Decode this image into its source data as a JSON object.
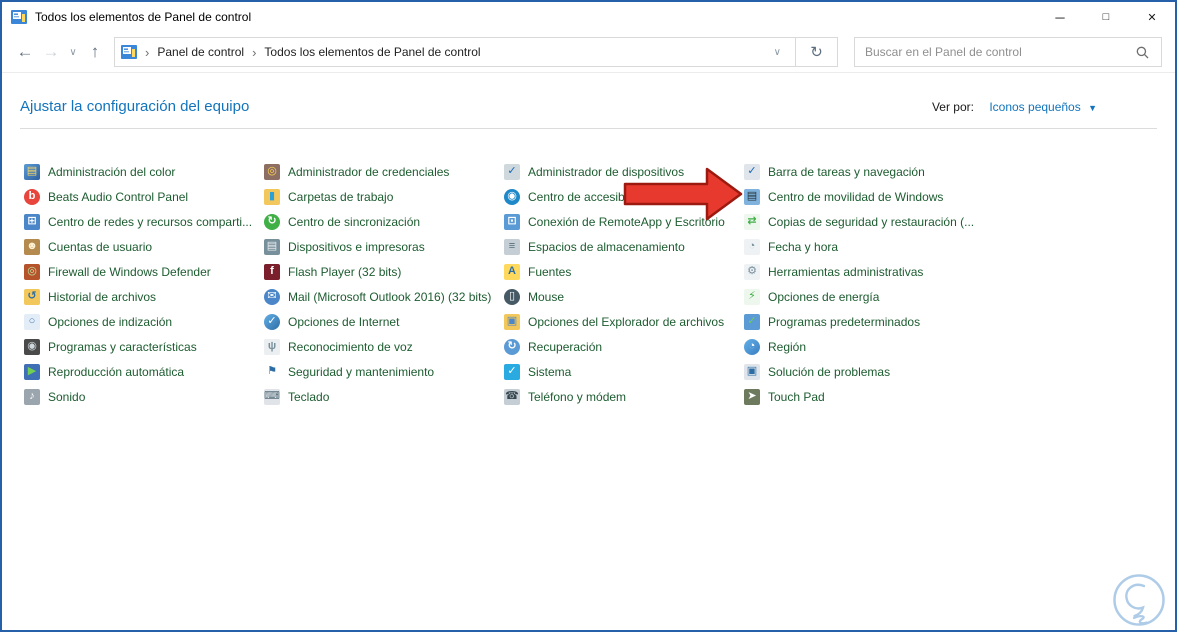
{
  "window": {
    "title": "Todos los elementos de Panel de control",
    "minimize_glyph": "─",
    "maximize_glyph": "□",
    "close_glyph": "✕"
  },
  "navbar": {
    "back_glyph": "←",
    "forward_glyph": "→",
    "dropdown_glyph": "∨",
    "up_glyph": "↑",
    "crumb_sep": "›",
    "breadcrumb_1": "Panel de control",
    "breadcrumb_2": "Todos los elementos de Panel de control",
    "address_dropdown_glyph": "∨",
    "refresh_glyph": "↻",
    "search_placeholder": "Buscar en el Panel de control"
  },
  "header": {
    "title": "Ajustar la configuración del equipo",
    "view_by_label": "Ver por:",
    "view_by_value": "Iconos pequeños",
    "view_by_caret": "▼"
  },
  "items": {
    "columns": [
      [
        {
          "label": "Administración del color",
          "icon": "color-management-icon",
          "glyph": "▤",
          "fg": "#ffd95e",
          "bg": "linear-gradient(135deg,#5b9bd5,#2e5f9e)"
        },
        {
          "label": "Beats Audio Control Panel",
          "icon": "beats-audio-icon",
          "glyph": "b",
          "fg": "#ffffff",
          "bg": "#e8453c",
          "shape": "round"
        },
        {
          "label": "Centro de redes y recursos comparti...",
          "icon": "network-sharing-center-icon",
          "glyph": "⊞",
          "fg": "#ffffff",
          "bg": "#4a86c8"
        },
        {
          "label": "Cuentas de usuario",
          "icon": "user-accounts-icon",
          "glyph": "☻",
          "fg": "#fff3d6",
          "bg": "#b58a4e"
        },
        {
          "label": "Firewall de Windows Defender",
          "icon": "windows-defender-firewall-icon",
          "glyph": "◎",
          "fg": "#bfe3a0",
          "bg": "#b5542a"
        },
        {
          "label": "Historial de archivos",
          "icon": "file-history-icon",
          "glyph": "↺",
          "fg": "#2e6da4",
          "bg": "#f2c75c"
        },
        {
          "label": "Opciones de indización",
          "icon": "indexing-options-icon",
          "glyph": "○",
          "fg": "#4a7db5",
          "bg": "#e3edf7"
        },
        {
          "label": "Programas y características",
          "icon": "programs-and-features-icon",
          "glyph": "◉",
          "fg": "#cfd8dc",
          "bg": "#4a4a4a"
        },
        {
          "label": "Reproducción automática",
          "icon": "autoplay-icon",
          "glyph": "▶",
          "fg": "#6fce53",
          "bg": "#3f6fb5"
        },
        {
          "label": "Sonido",
          "icon": "sound-icon",
          "glyph": "♪",
          "fg": "#ffffff",
          "bg": "#9aa5ad"
        }
      ],
      [
        {
          "label": "Administrador de credenciales",
          "icon": "credential-manager-icon",
          "glyph": "◎",
          "fg": "#ffd54f",
          "bg": "#8d6e63"
        },
        {
          "label": "Carpetas de trabajo",
          "icon": "work-folders-icon",
          "glyph": "▮",
          "fg": "#29a0d8",
          "bg": "#f2c75c"
        },
        {
          "label": "Centro de sincronización",
          "icon": "sync-center-icon",
          "glyph": "↻",
          "fg": "#ffffff",
          "bg": "#3faf46",
          "shape": "round"
        },
        {
          "label": "Dispositivos e impresoras",
          "icon": "devices-and-printers-icon",
          "glyph": "▤",
          "fg": "#eceff1",
          "bg": "#78909c"
        },
        {
          "label": "Flash Player (32 bits)",
          "icon": "flash-player-icon",
          "glyph": "f",
          "fg": "#ffffff",
          "bg": "#7a1f2b"
        },
        {
          "label": "Mail (Microsoft Outlook 2016) (32 bits)",
          "icon": "mail-icon",
          "glyph": "✉",
          "fg": "#ffffff",
          "bg": "#4a86c8",
          "shape": "round"
        },
        {
          "label": "Opciones de Internet",
          "icon": "internet-options-icon",
          "glyph": "✓",
          "fg": "#ffffff",
          "bg": "linear-gradient(135deg,#62b0e8,#2e6da4)",
          "shape": "round"
        },
        {
          "label": "Reconocimiento de voz",
          "icon": "speech-recognition-icon",
          "glyph": "ψ",
          "fg": "#78909c",
          "bg": "#eceff1"
        },
        {
          "label": "Seguridad y mantenimiento",
          "icon": "security-and-maintenance-icon",
          "glyph": "⚑",
          "fg": "#2e6da4",
          "bg": "#ffffff"
        },
        {
          "label": "Teclado",
          "icon": "keyboard-icon",
          "glyph": "⌨",
          "fg": "#546e7a",
          "bg": "#e0e4e8"
        }
      ],
      [
        {
          "label": "Administrador de dispositivos",
          "icon": "device-manager-icon",
          "glyph": "✓",
          "fg": "#1565c0",
          "bg": "#cfd8dc"
        },
        {
          "label": "Centro de accesibilidad",
          "icon": "ease-of-access-center-icon",
          "glyph": "◉",
          "fg": "#ffffff",
          "bg": "#1e88c8",
          "shape": "round"
        },
        {
          "label": "Conexión de RemoteApp y Escritorio",
          "icon": "remoteapp-desktop-icon",
          "glyph": "⊡",
          "fg": "#ffffff",
          "bg": "#5b9bd5"
        },
        {
          "label": "Espacios de almacenamiento",
          "icon": "storage-spaces-icon",
          "glyph": "≡",
          "fg": "#546e7a",
          "bg": "#c5ced4"
        },
        {
          "label": "Fuentes",
          "icon": "fonts-icon",
          "glyph": "A",
          "fg": "#2e6da4",
          "bg": "#ffd95e"
        },
        {
          "label": "Mouse",
          "icon": "mouse-icon",
          "glyph": "▯",
          "fg": "#ffffff",
          "bg": "#455a64",
          "shape": "round"
        },
        {
          "label": "Opciones del Explorador de archivos",
          "icon": "file-explorer-options-icon",
          "glyph": "▣",
          "fg": "#4a86c8",
          "bg": "#f2c75c"
        },
        {
          "label": "Recuperación",
          "icon": "recovery-icon",
          "glyph": "↻",
          "fg": "#ffffff",
          "bg": "#5b9bd5",
          "shape": "round"
        },
        {
          "label": "Sistema",
          "icon": "system-icon",
          "glyph": "✓",
          "fg": "#ffffff",
          "bg": "#29abe2"
        },
        {
          "label": "Teléfono y módem",
          "icon": "phone-and-modem-icon",
          "glyph": "☎",
          "fg": "#37474f",
          "bg": "#c5ced4"
        }
      ],
      [
        {
          "label": "Barra de tareas y navegación",
          "icon": "taskbar-navigation-icon",
          "glyph": "✓",
          "fg": "#1565c0",
          "bg": "#dfe5ea"
        },
        {
          "label": "Centro de movilidad de Windows",
          "icon": "windows-mobility-center-icon",
          "glyph": "▤",
          "fg": "#263238",
          "bg": "#7fb3dd"
        },
        {
          "label": "Copias de seguridad y restauración (...",
          "icon": "backup-and-restore-icon",
          "glyph": "⇄",
          "fg": "#3faf46",
          "bg": "#eef7ee"
        },
        {
          "label": "Fecha y hora",
          "icon": "date-and-time-icon",
          "glyph": "◔",
          "fg": "#78909c",
          "bg": "#eef2f5"
        },
        {
          "label": "Herramientas administrativas",
          "icon": "administrative-tools-icon",
          "glyph": "⚙",
          "fg": "#78909c",
          "bg": "#eef2f5"
        },
        {
          "label": "Opciones de energía",
          "icon": "power-options-icon",
          "glyph": "⚡",
          "fg": "#3faf46",
          "bg": "#eef7ee"
        },
        {
          "label": "Programas predeterminados",
          "icon": "default-programs-icon",
          "glyph": "✓",
          "fg": "#6fce53",
          "bg": "#5b9bd5"
        },
        {
          "label": "Región",
          "icon": "region-icon",
          "glyph": "◔",
          "fg": "#ffffff",
          "bg": "linear-gradient(135deg,#62b0e8,#3a7ec2)",
          "shape": "round"
        },
        {
          "label": "Solución de problemas",
          "icon": "troubleshooting-icon",
          "glyph": "▣",
          "fg": "#2e6da4",
          "bg": "#dfe5ea"
        },
        {
          "label": "Touch Pad",
          "icon": "touchpad-icon",
          "glyph": "➤",
          "fg": "#ffffff",
          "bg": "#6d7a5e"
        }
      ]
    ]
  },
  "annotation": {
    "arrow_fill": "#e8392e",
    "arrow_stroke": "#9c1a10"
  },
  "logo_color": "#aecce8",
  "frame_border_color": "#2660a8"
}
